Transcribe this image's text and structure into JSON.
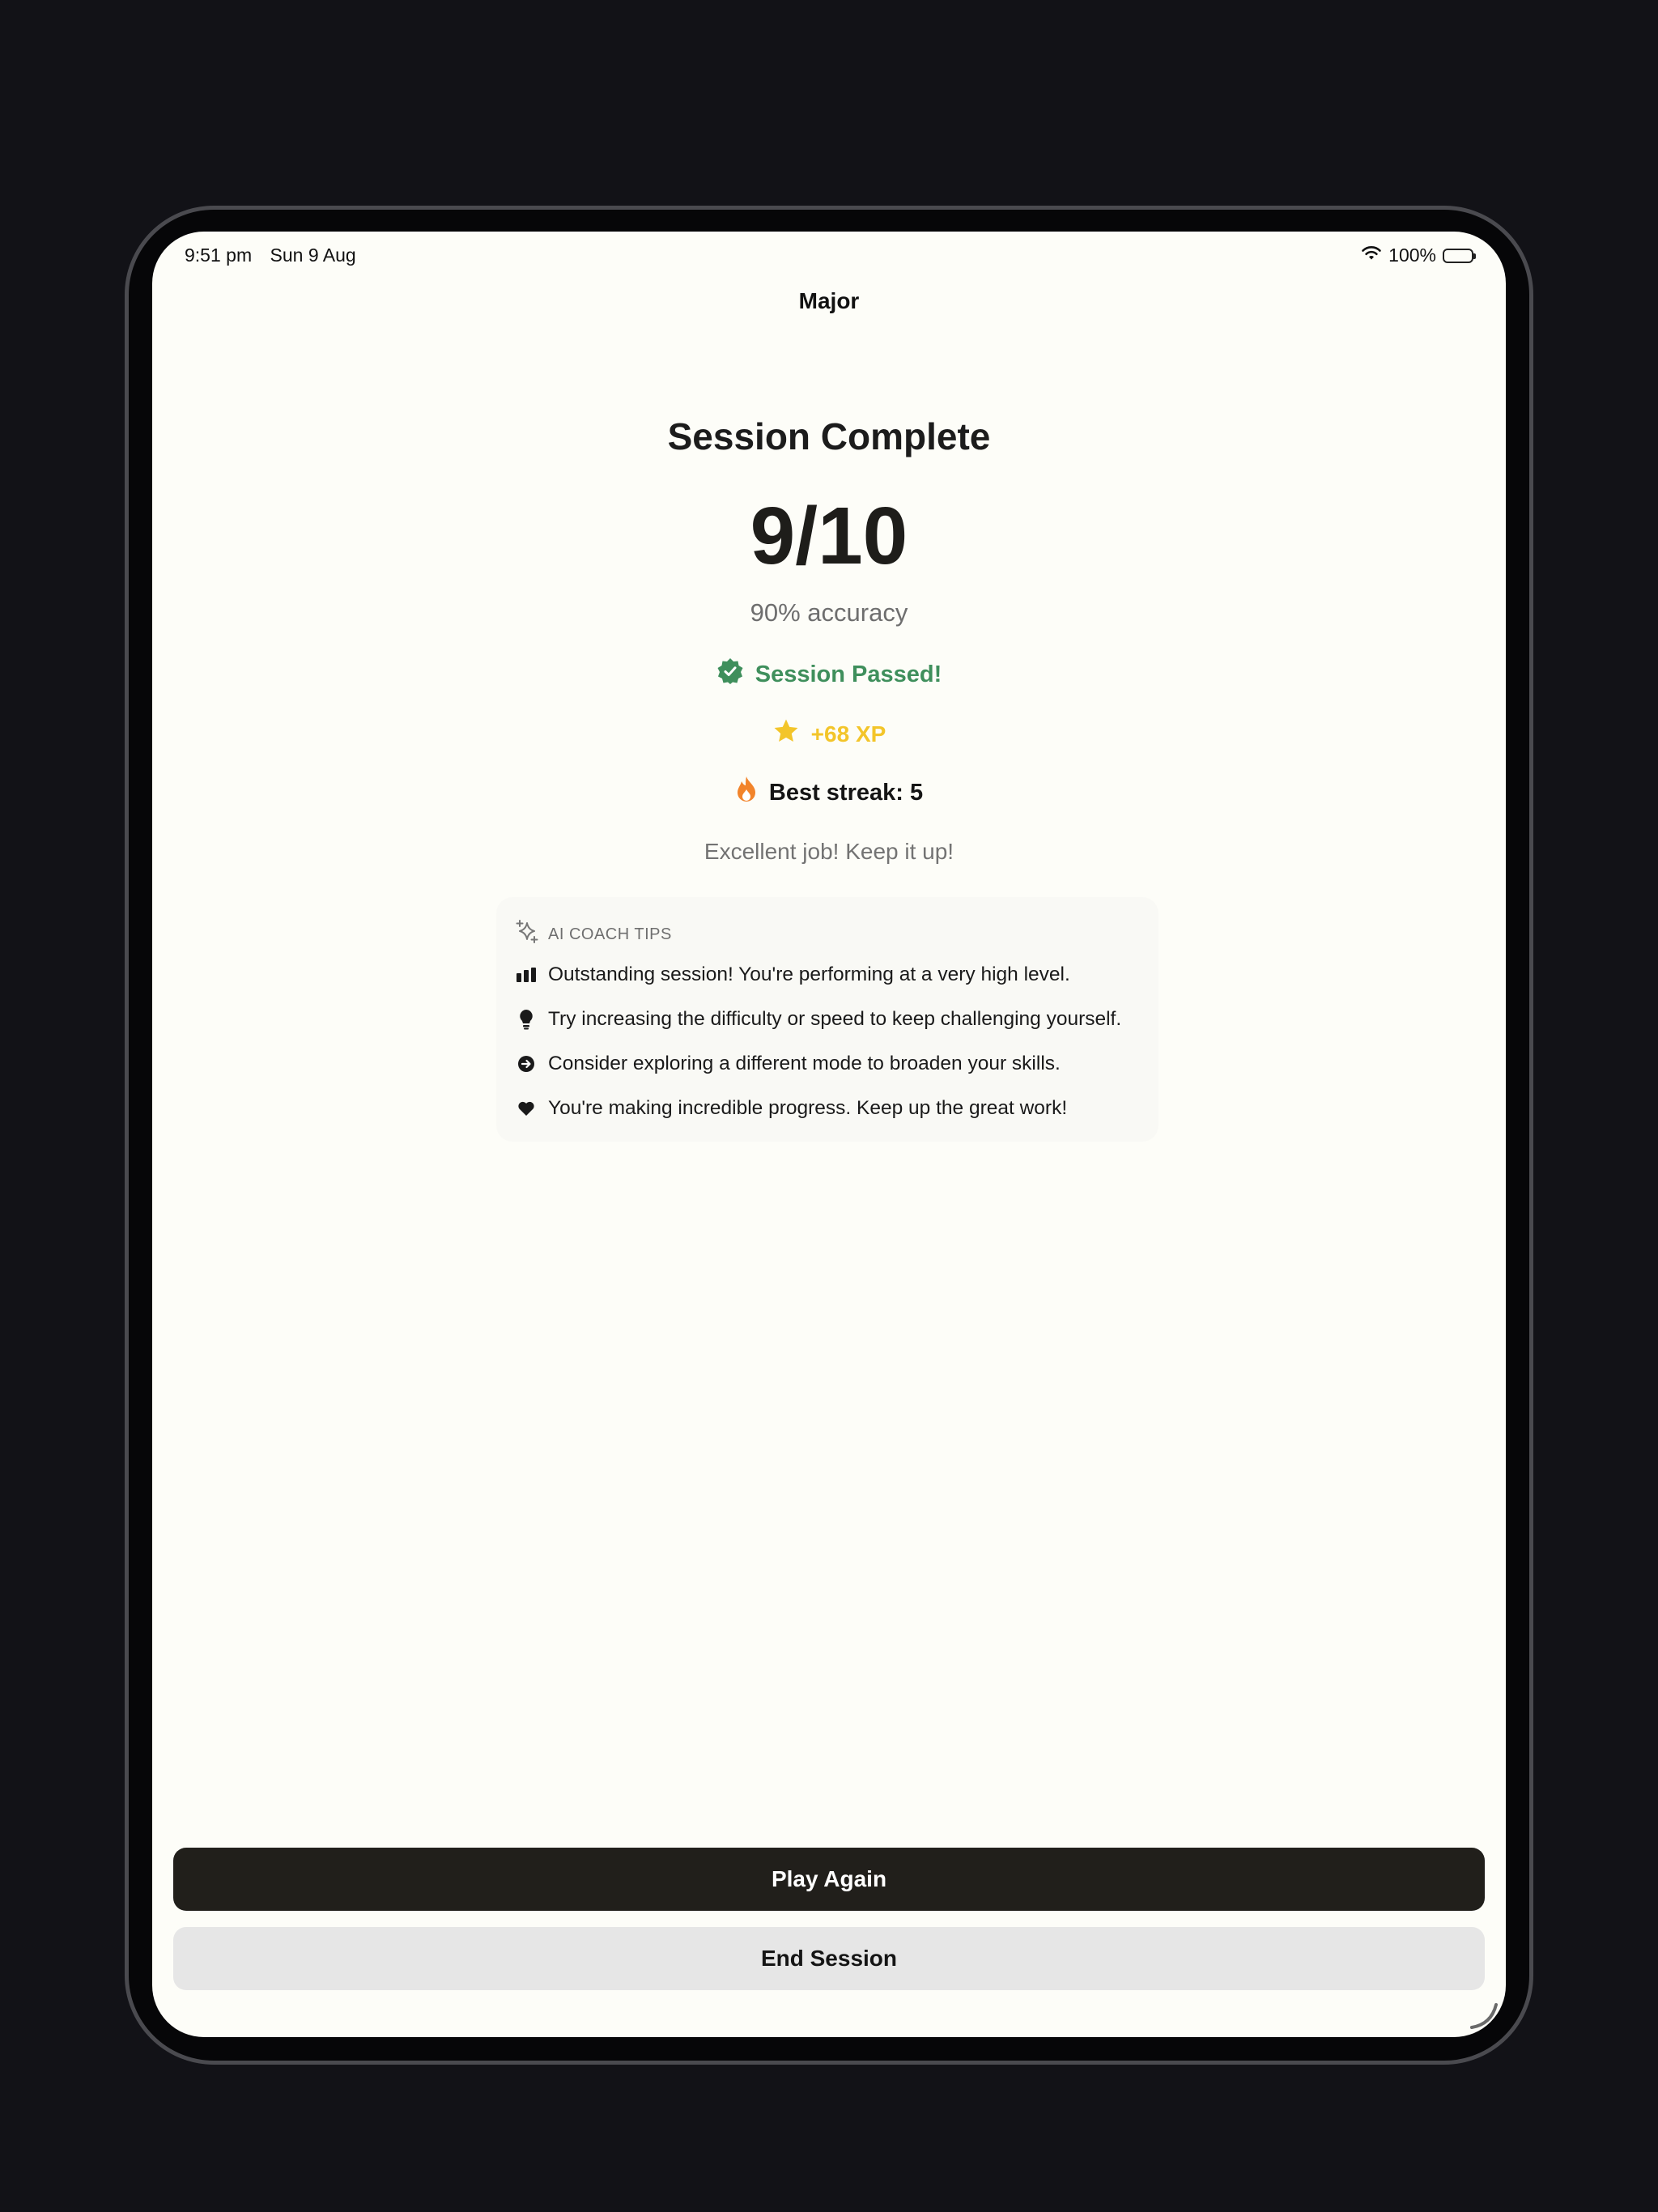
{
  "status_bar": {
    "time": "9:51 pm",
    "date": "Sun 9 Aug",
    "battery": "100%",
    "icons": [
      "wifi-icon",
      "battery-icon"
    ]
  },
  "nav": {
    "title": "Major"
  },
  "result": {
    "heading": "Session Complete",
    "score": "9/10",
    "accuracy": "90% accuracy",
    "passed": "Session Passed!",
    "xp": "+68 XP",
    "streak": "Best streak: 5",
    "encouragement": "Excellent job! Keep it up!"
  },
  "coach": {
    "title": "AI COACH TIPS",
    "tips": [
      {
        "icon": "chart-bars-icon",
        "text": "Outstanding session! You're performing at a very high level."
      },
      {
        "icon": "lightbulb-icon",
        "text": "Try increasing the difficulty or speed to keep challenging yourself."
      },
      {
        "icon": "arrow-circle-icon",
        "text": "Consider exploring a different mode to broaden your skills."
      },
      {
        "icon": "heart-icon",
        "text": "You're making incredible progress. Keep up the great work!"
      }
    ]
  },
  "actions": {
    "play_again": "Play Again",
    "end_session": "End Session"
  },
  "colors": {
    "background": "#fdfdf8",
    "passed_green": "#3f8f5c",
    "xp_gold": "#f3c52a",
    "streak_orange": "#f2842b",
    "primary_button": "#211f1b",
    "secondary_button": "#e6e6e6"
  }
}
